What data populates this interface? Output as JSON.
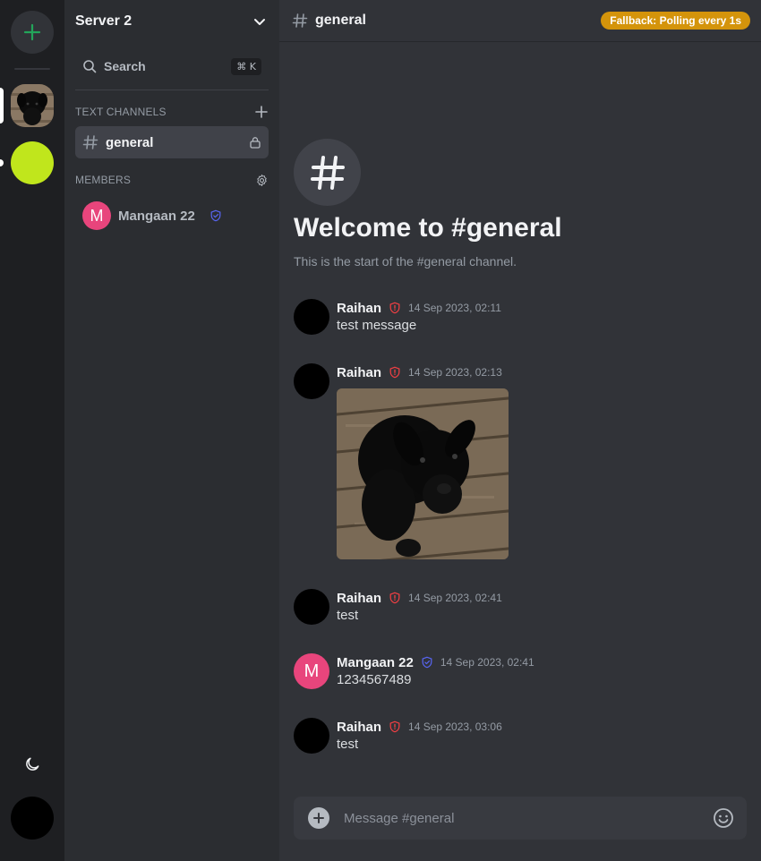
{
  "server": {
    "name": "Server 2"
  },
  "search": {
    "label": "Search",
    "shortcut": "⌘ K"
  },
  "sidebar": {
    "text_channels_title": "TEXT CHANNELS",
    "members_title": "MEMBERS",
    "channels": [
      {
        "label": "general"
      }
    ],
    "members": [
      {
        "initial": "M",
        "name": "Mangaan 22"
      }
    ]
  },
  "channel": {
    "name": "general",
    "status_badge": "Fallback: Polling every 1s",
    "welcome_title": "Welcome to #general",
    "welcome_subtitle": "This is the start of the #general channel."
  },
  "messages": [
    {
      "author": "Raihan",
      "time": "14 Sep 2023, 02:11",
      "text": "test message",
      "role_icon": "shield-alert-icon"
    },
    {
      "author": "Raihan",
      "time": "14 Sep 2023, 02:13",
      "attachment": "black-puppy-photo",
      "role_icon": "shield-alert-icon"
    },
    {
      "author": "Raihan",
      "time": "14 Sep 2023, 02:41",
      "text": "test",
      "role_icon": "shield-alert-icon"
    },
    {
      "author": "Mangaan 22",
      "initial": "M",
      "time": "14 Sep 2023, 02:41",
      "text": "1234567489",
      "role_icon": "shield-check-icon"
    },
    {
      "author": "Raihan",
      "time": "14 Sep 2023, 03:06",
      "text": "test",
      "role_icon": "shield-alert-icon"
    }
  ],
  "composer": {
    "placeholder": "Message #general"
  },
  "colors": {
    "accent_green": "#23a55a",
    "badge_orange": "#d4940b",
    "admin_red": "#f23f43",
    "moderator_blue": "#5865f2",
    "member_pink": "#e8457c",
    "server_lime": "#c0e61c"
  }
}
